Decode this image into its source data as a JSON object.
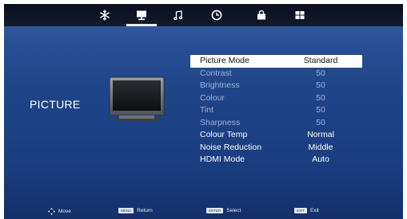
{
  "top_tabs": [
    {
      "icon": "snowflake-settings-icon",
      "active": false
    },
    {
      "icon": "monitor-icon",
      "active": true
    },
    {
      "icon": "music-note-icon",
      "active": false
    },
    {
      "icon": "clock-icon",
      "active": false
    },
    {
      "icon": "lock-icon",
      "active": false
    },
    {
      "icon": "grid-icon",
      "active": false
    }
  ],
  "category": {
    "label": "PICTURE",
    "illustration": "tv-set-icon"
  },
  "menu": {
    "rows": [
      {
        "label": "Picture Mode",
        "value": "Standard",
        "state": "selected"
      },
      {
        "label": "Contrast",
        "value": "50",
        "state": "dim"
      },
      {
        "label": "Brightness",
        "value": "50",
        "state": "dim"
      },
      {
        "label": "Colour",
        "value": "50",
        "state": "dim"
      },
      {
        "label": "Tint",
        "value": "50",
        "state": "dim"
      },
      {
        "label": "Sharpness",
        "value": "50",
        "state": "dim"
      },
      {
        "label": "Colour Temp",
        "value": "Normal",
        "state": "bright"
      },
      {
        "label": "Noise Reduction",
        "value": "Middle",
        "state": "bright"
      },
      {
        "label": "HDMI Mode",
        "value": "Auto",
        "state": "bright"
      }
    ]
  },
  "hints": {
    "move": {
      "label": "Move"
    },
    "menu": {
      "key": "MENU",
      "label": "Return"
    },
    "enter": {
      "key": "ENTER",
      "label": "Select"
    },
    "exit": {
      "key": "EXIT",
      "label": "Exit"
    }
  },
  "colors": {
    "accent_selected_bg": "#ffffff",
    "background": "#1f4488",
    "topbar": "#0c1222"
  }
}
